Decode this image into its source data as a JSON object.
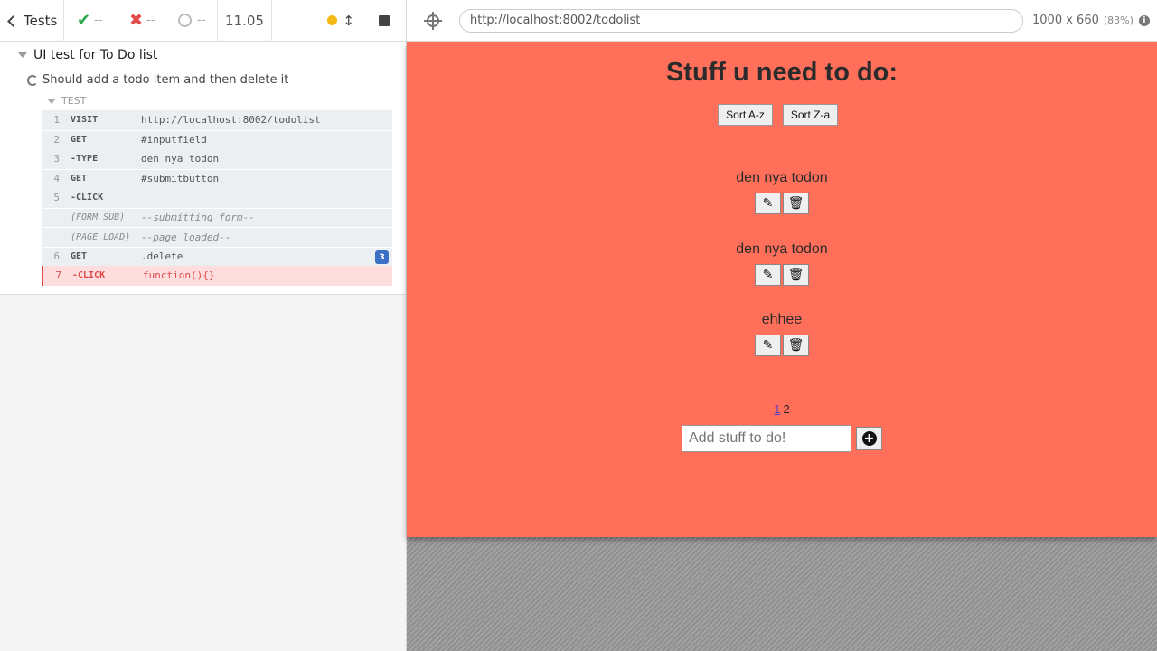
{
  "reporter": {
    "tests_label": "Tests",
    "passed": "--",
    "failed": "--",
    "pending": "--",
    "duration": "11.05",
    "suite_title": "UI test for To Do list",
    "test_title": "Should add a todo item and then delete it",
    "test_section_label": "TEST",
    "commands": [
      {
        "num": "1",
        "name": "VISIT",
        "message": "http://localhost:8002/todolist"
      },
      {
        "num": "2",
        "name": "GET",
        "message": "#inputfield"
      },
      {
        "num": "3",
        "name": "-TYPE",
        "message": "den nya todon"
      },
      {
        "num": "4",
        "name": "GET",
        "message": "#submitbutton"
      },
      {
        "num": "5",
        "name": "-CLICK",
        "message": ""
      },
      {
        "num": "",
        "name": "(FORM SUB)",
        "message": "--submitting form--"
      },
      {
        "num": "",
        "name": "(PAGE LOAD)",
        "message": "--page loaded--"
      },
      {
        "num": "6",
        "name": "GET",
        "message": ".delete",
        "badge": "3"
      },
      {
        "num": "7",
        "name": "-CLICK",
        "message": "function(){}"
      }
    ]
  },
  "aut": {
    "url": "http://localhost:8002/todolist",
    "viewport_size": "1000 x 660",
    "viewport_scale": "(83%)",
    "app": {
      "title": "Stuff u need to do:",
      "sort_az": "Sort A-z",
      "sort_za": "Sort Z-a",
      "todos": [
        "den nya todon",
        "den nya todon",
        "ehhee"
      ],
      "pages": [
        "1",
        "2"
      ],
      "input_placeholder": "Add stuff to do!"
    }
  },
  "colors": {
    "app_background": "#ff6f59",
    "passed": "#2aa84a",
    "failed": "#e24b4b",
    "badge": "#3a6fc4"
  }
}
